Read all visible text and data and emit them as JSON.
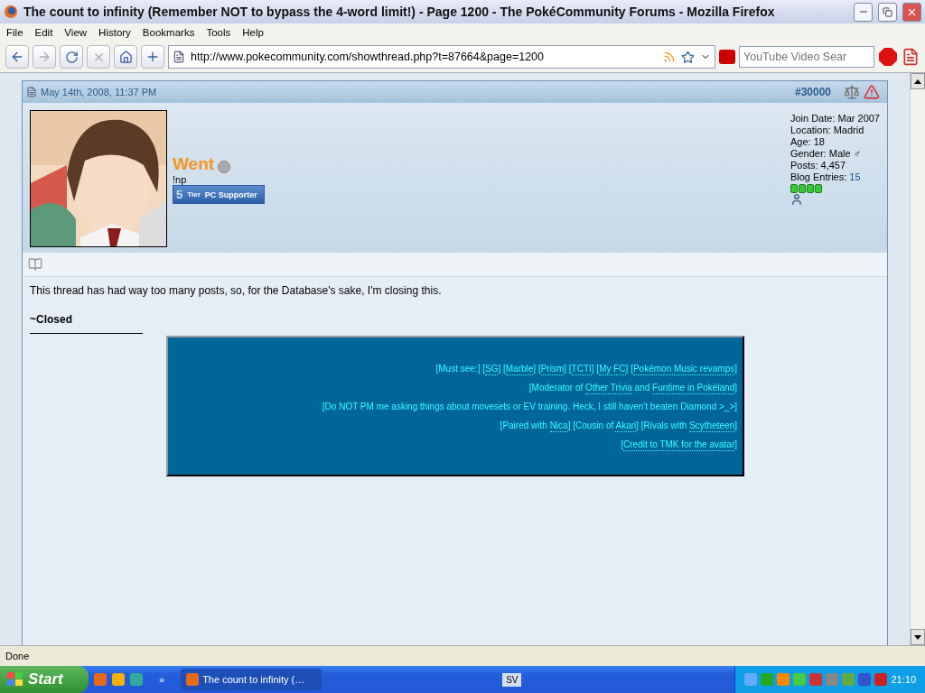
{
  "window": {
    "title": "The count to infinity (Remember NOT to bypass the 4-word limit!) - Page 1200 - The PokéCommunity Forums - Mozilla Firefox"
  },
  "menu": [
    "File",
    "Edit",
    "View",
    "History",
    "Bookmarks",
    "Tools",
    "Help"
  ],
  "toolbar": {
    "url": "http://www.pokecommunity.com/showthread.php?t=87664&page=1200",
    "search_placeholder": "YouTube Video Sear",
    "back_disabled": false,
    "forward_disabled": true,
    "stop_disabled": true
  },
  "post": {
    "date": "May 14th, 2008, 11:37 PM",
    "number": "#30000",
    "user": {
      "name": "Went",
      "online": false,
      "title": "!np",
      "badge_num": "5",
      "badge_tier": "Tier",
      "badge_label": "PC Supporter"
    },
    "info": [
      {
        "label": "Join Date:",
        "value": "Mar 2007",
        "link": false
      },
      {
        "label": "Location:",
        "value": "Madrid",
        "link": false
      },
      {
        "label": "Age:",
        "value": "18",
        "link": false
      },
      {
        "label": "Gender:",
        "value": "Male ♂",
        "link": false
      },
      {
        "label": "Posts:",
        "value": "4,457",
        "link": false
      },
      {
        "label": "Blog Entries:",
        "value": "15",
        "link": true
      }
    ],
    "message": "This thread has had way too many posts, so, for the Database's sake, I'm closing this.",
    "closing": "~Closed",
    "signature": [
      [
        {
          "text": "[Must see:] [",
          "link": false
        },
        {
          "text": "SG",
          "link": true
        },
        {
          "text": "] [",
          "link": false
        },
        {
          "text": "Marble",
          "link": true
        },
        {
          "text": "] [",
          "link": false
        },
        {
          "text": "Prism",
          "link": true
        },
        {
          "text": "] [",
          "link": false
        },
        {
          "text": "TCTI",
          "link": true
        },
        {
          "text": "] [",
          "link": false
        },
        {
          "text": "My FC",
          "link": true
        },
        {
          "text": "] [",
          "link": false
        },
        {
          "text": "Pokémon Music revamps",
          "link": true
        },
        {
          "text": "]",
          "link": false
        }
      ],
      [
        {
          "text": "[Moderator of ",
          "link": false
        },
        {
          "text": "Other Trivia",
          "link": true
        },
        {
          "text": " and ",
          "link": false
        },
        {
          "text": "Funtime in Pokéland",
          "link": true
        },
        {
          "text": "]",
          "link": false
        }
      ],
      [
        {
          "text": "[Do NOT PM me asking things about movesets or EV training. Heck, I still haven't beaten Diamond >_>]",
          "link": false
        }
      ],
      [
        {
          "text": "[Paired with ",
          "link": false
        },
        {
          "text": "Nica",
          "link": true
        },
        {
          "text": "] [Cousin of ",
          "link": false
        },
        {
          "text": "Akari",
          "link": true
        },
        {
          "text": "] [Rivals with ",
          "link": false
        },
        {
          "text": "Scytheteen",
          "link": true
        },
        {
          "text": "]",
          "link": false
        }
      ],
      [
        {
          "text": "[",
          "link": false
        },
        {
          "text": "Credit to TMK for the avatar",
          "link": true
        },
        {
          "text": "]",
          "link": false
        }
      ]
    ]
  },
  "status_bar": "Done",
  "taskbar": {
    "start": "Start",
    "overflow": "»",
    "tasks": [
      {
        "label": "The count to infinity (…",
        "selected": true
      }
    ],
    "language": "SV",
    "clock": "21:10"
  }
}
